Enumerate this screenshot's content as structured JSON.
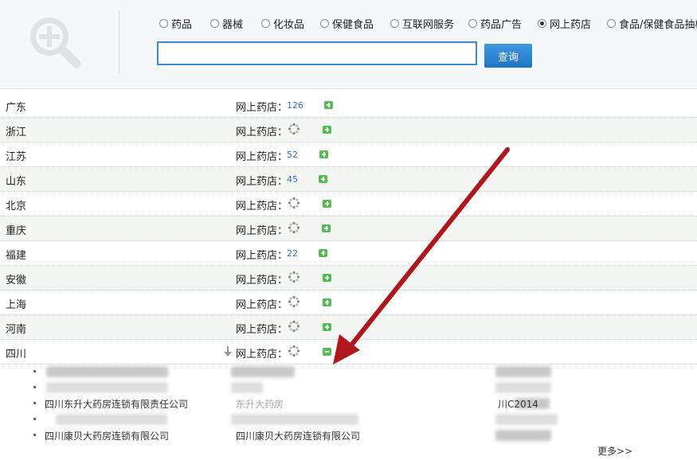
{
  "search": {
    "options": [
      {
        "label": "药品",
        "checked": false
      },
      {
        "label": "器械",
        "checked": false
      },
      {
        "label": "化妆品",
        "checked": false
      },
      {
        "label": "保健食品",
        "checked": false
      },
      {
        "label": "互联网服务",
        "checked": false
      },
      {
        "label": "药品广告",
        "checked": false
      },
      {
        "label": "网上药店",
        "checked": true
      },
      {
        "label": "食品/保健食品抽检",
        "checked": false
      }
    ],
    "input_value": "",
    "button_label": "查询"
  },
  "list": {
    "label": "网上药店：",
    "rows": [
      {
        "province": "广东",
        "count": "126"
      },
      {
        "province": "浙江",
        "count": null
      },
      {
        "province": "江苏",
        "count": "52"
      },
      {
        "province": "山东",
        "count": "45"
      },
      {
        "province": "北京",
        "count": null
      },
      {
        "province": "重庆",
        "count": null
      },
      {
        "province": "福建",
        "count": "22"
      },
      {
        "province": "安徽",
        "count": null
      },
      {
        "province": "上海",
        "count": null
      },
      {
        "province": "河南",
        "count": null
      },
      {
        "province": "四川",
        "count": null,
        "expanded": true
      }
    ],
    "expanded_items": [
      {
        "company": "",
        "shop": "",
        "license": ""
      },
      {
        "company": "",
        "shop": "",
        "license": ""
      },
      {
        "company": "四川东升大药房连锁有限责任公司",
        "shop": "东升大药房",
        "license": "川C2014"
      },
      {
        "company": "",
        "shop": "",
        "license": ""
      },
      {
        "company": "四川康贝大药房连锁有限公司",
        "shop": "四川康贝大药房连锁有限公司",
        "license": ""
      }
    ],
    "more_label": "更多>>"
  },
  "colors": {
    "accent": "#2a78cc",
    "plus": "#4fbf4f",
    "arrow": "#b0161b"
  }
}
